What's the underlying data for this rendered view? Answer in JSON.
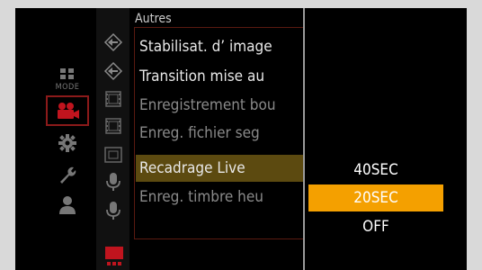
{
  "header": {
    "title": "Autres"
  },
  "categories": [
    {
      "icon": "mode-icon",
      "label": "MODE"
    },
    {
      "icon": "video-camera-icon",
      "label": ""
    },
    {
      "icon": "gear-icon",
      "label": ""
    },
    {
      "icon": "wrench-icon",
      "label": ""
    },
    {
      "icon": "person-icon",
      "label": ""
    }
  ],
  "tabs": [
    {
      "icon": "diamond-arrow-icon"
    },
    {
      "icon": "diamond-arrow-icon"
    },
    {
      "icon": "film-icon"
    },
    {
      "icon": "film-icon"
    },
    {
      "icon": "frame-icon"
    },
    {
      "icon": "microphone-icon"
    },
    {
      "icon": "microphone-icon"
    },
    {
      "icon": "rec-icon"
    }
  ],
  "menu_items": [
    {
      "label": "Stabilisat. d’ image"
    },
    {
      "label": "Transition mise au"
    },
    {
      "label": "Enregistrement bou"
    },
    {
      "label": "Enreg. fichier seg"
    },
    {
      "label": "Recadrage Live"
    },
    {
      "label": "Enreg. timbre heu"
    }
  ],
  "options": [
    {
      "label": "40SEC"
    },
    {
      "label": "20SEC"
    },
    {
      "label": "OFF"
    }
  ],
  "colors": {
    "highlight_menu": "#5c4a10",
    "highlight_option": "#f4a000",
    "accent_red": "#c0141e"
  }
}
